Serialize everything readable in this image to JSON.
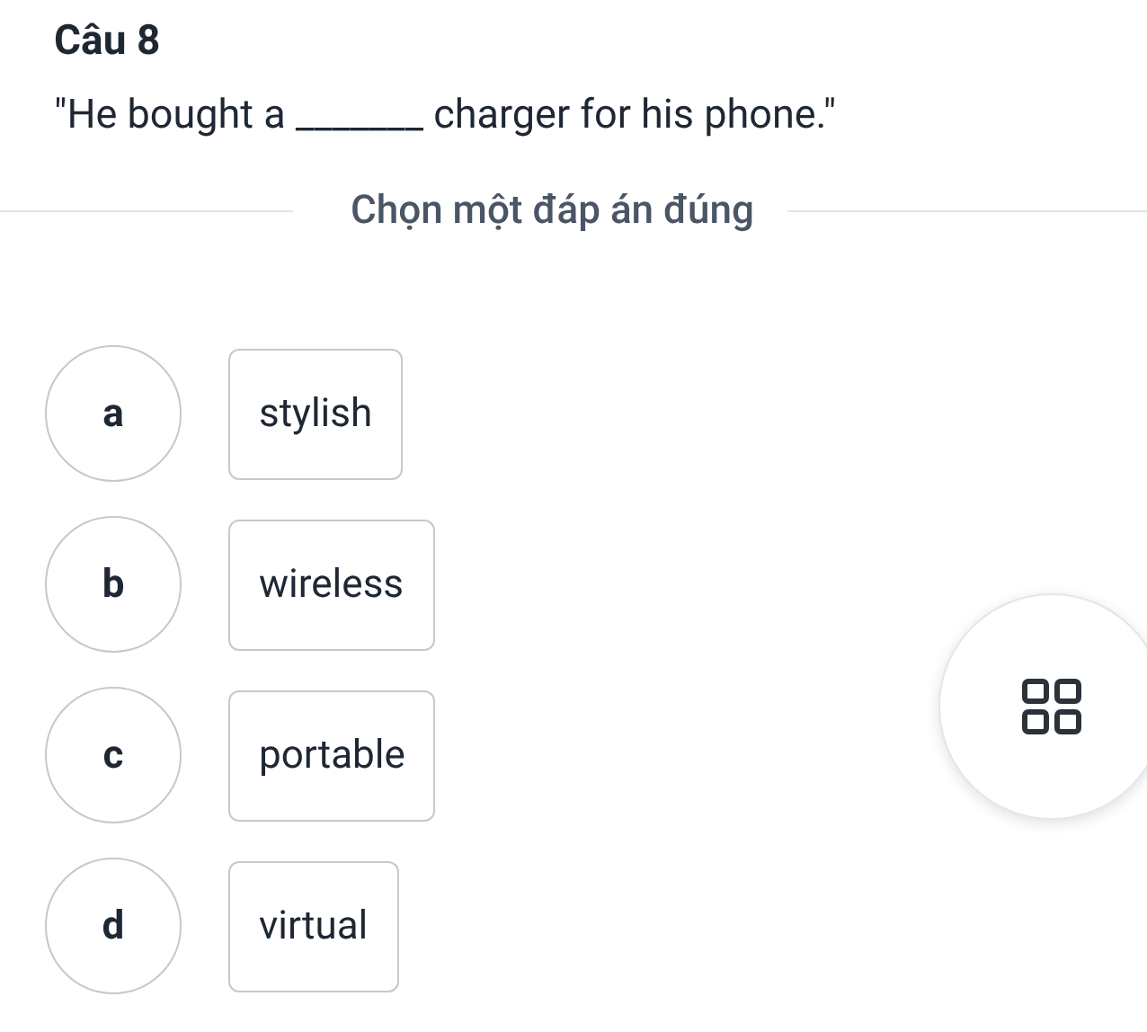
{
  "question": {
    "title": "Câu 8",
    "text": "\"He bought a _______ charger for his phone.\""
  },
  "instruction": "Chọn một đáp án đúng",
  "options": [
    {
      "letter": "a",
      "text": "stylish"
    },
    {
      "letter": "b",
      "text": "wireless"
    },
    {
      "letter": "c",
      "text": "portable"
    },
    {
      "letter": "d",
      "text": "virtual"
    }
  ]
}
